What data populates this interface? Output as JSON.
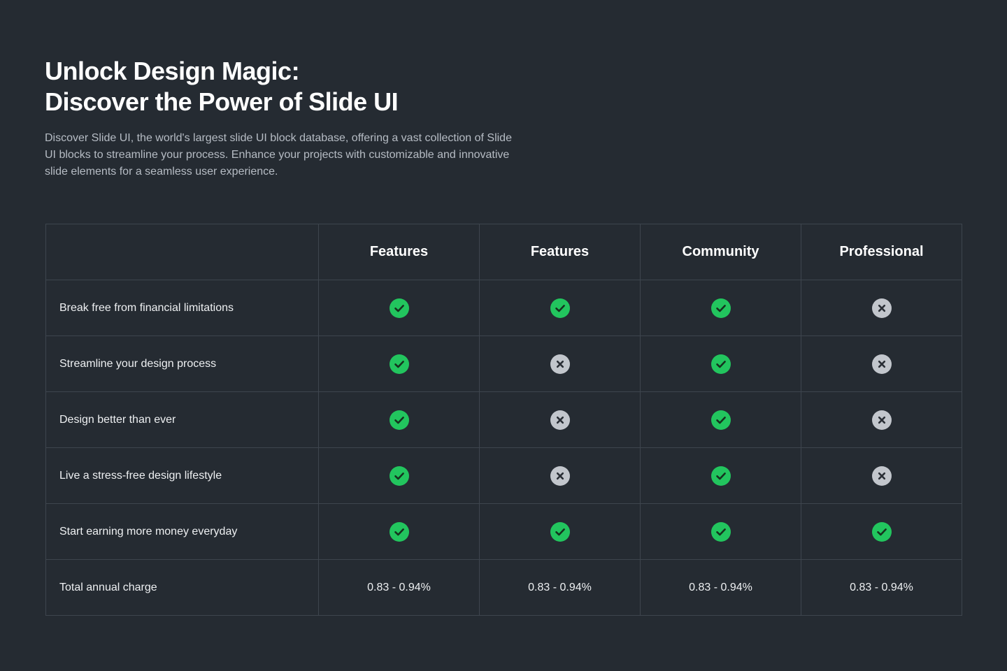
{
  "hero": {
    "title_line1": "Unlock Design Magic:",
    "title_line2": "Discover the Power of Slide UI",
    "description": "Discover Slide UI, the world's largest slide UI block database, offering a vast collection of Slide UI blocks to streamline your process. Enhance your projects with customizable and innovative slide elements for a seamless user experience."
  },
  "table": {
    "columns": [
      "Features",
      "Features",
      "Community",
      "Professional"
    ],
    "rows": [
      {
        "label": "Break free from financial limitations",
        "values": [
          "check-icon",
          "check-icon",
          "check-icon",
          "cross-icon"
        ]
      },
      {
        "label": "Streamline your design process",
        "values": [
          "check-icon",
          "cross-icon",
          "check-icon",
          "cross-icon"
        ]
      },
      {
        "label": "Design better than ever",
        "values": [
          "check-icon",
          "cross-icon",
          "check-icon",
          "cross-icon"
        ]
      },
      {
        "label": "Live a stress-free design lifestyle",
        "values": [
          "check-icon",
          "cross-icon",
          "check-icon",
          "cross-icon"
        ]
      },
      {
        "label": "Start earning more money everyday",
        "values": [
          "check-icon",
          "check-icon",
          "check-icon",
          "check-icon"
        ]
      }
    ],
    "total": {
      "label": "Total annual charge",
      "values": [
        "0.83 - 0.94%",
        "0.83 - 0.94%",
        "0.83 - 0.94%",
        "0.83 - 0.94%"
      ]
    }
  },
  "colors": {
    "background": "#252b32",
    "check": "#22c55e",
    "cross": "#c2c6cc",
    "border": "#3e454e"
  }
}
